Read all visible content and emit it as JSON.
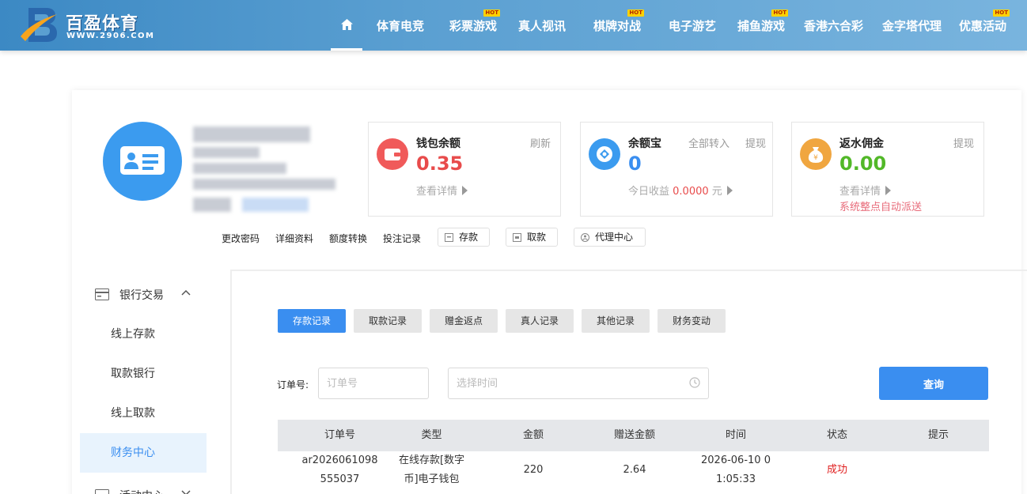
{
  "brand": {
    "name": "百盈体育",
    "url": "WWW.2906.COM",
    "colors": {
      "primary": "#3a8ef0",
      "header": "#5a9fd1",
      "hot": "#ffd200"
    }
  },
  "nav": {
    "hot_label": "HOT",
    "items": [
      {
        "label": "体育电竞",
        "hot": false
      },
      {
        "label": "彩票游戏",
        "hot": true
      },
      {
        "label": "真人视讯",
        "hot": false
      },
      {
        "label": "棋牌对战",
        "hot": true
      },
      {
        "label": "电子游艺",
        "hot": false
      },
      {
        "label": "捕鱼游戏",
        "hot": true
      },
      {
        "label": "香港六合彩",
        "hot": false
      },
      {
        "label": "金字塔代理",
        "hot": false
      },
      {
        "label": "优惠活动",
        "hot": true
      }
    ]
  },
  "wallet": {
    "title": "钱包余额",
    "value": "0.35",
    "action": "刷新",
    "detail": "查看详情"
  },
  "yuebao": {
    "title": "余额宝",
    "value": "0",
    "action_in": "全部转入",
    "action_out": "提现",
    "income_label": "今日收益",
    "income_value": "0.0000",
    "income_unit": "元"
  },
  "rebate": {
    "title": "返水佣金",
    "value": "0.00",
    "action": "提现",
    "detail": "查看详情",
    "note": "系统整点自动派送"
  },
  "links": {
    "change_password": "更改密码",
    "profile": "详细资料",
    "transfer": "额度转换",
    "bet_record": "投注记录",
    "deposit": "存款",
    "withdraw": "取款",
    "agent": "代理中心"
  },
  "sidebar": {
    "section_title": "银行交易",
    "items": [
      "线上存款",
      "取款银行",
      "线上取款",
      "财务中心"
    ],
    "next_section": "活动中心"
  },
  "tabs": [
    "存款记录",
    "取款记录",
    "赠金返点",
    "真人记录",
    "其他记录",
    "财务变动"
  ],
  "filter": {
    "order_label": "订单号:",
    "order_placeholder": "订单号",
    "time_placeholder": "选择时间",
    "query_button": "查询"
  },
  "table": {
    "headers": [
      "订单号",
      "类型",
      "金额",
      "赠送金额",
      "时间",
      "状态",
      "提示"
    ],
    "rows": [
      {
        "order_l1": "ar2026061098",
        "order_l2": "555037",
        "type_l1": "在线存款[数字",
        "type_l2": "币]电子钱包",
        "amount": "220",
        "bonus": "2.64",
        "time_l1": "2026-06-10 0",
        "time_l2": "1:05:33",
        "status": "成功",
        "tip": ""
      }
    ]
  }
}
